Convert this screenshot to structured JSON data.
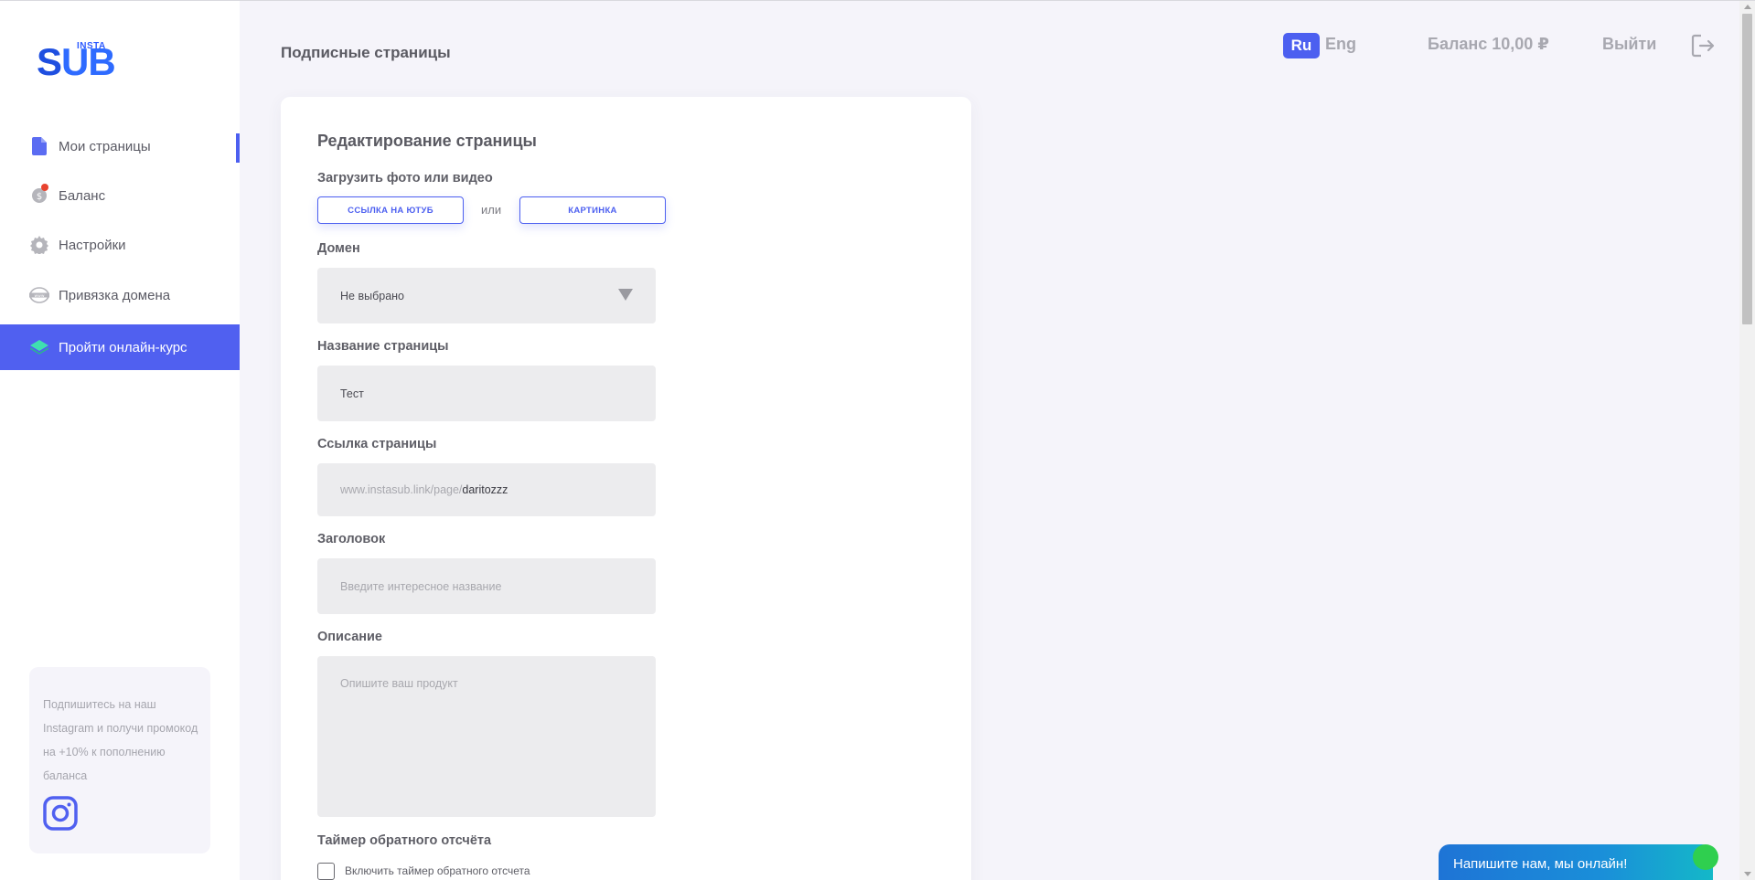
{
  "logo": {
    "insta": "INSTA",
    "sub_s": "S",
    "sub_rest": "UB"
  },
  "sidebar": {
    "items": [
      {
        "label": "Мои страницы",
        "icon": "document-icon"
      },
      {
        "label": "Баланс",
        "icon": "coin-icon"
      },
      {
        "label": "Настройки",
        "icon": "gear-icon"
      },
      {
        "label": "Привязка домена",
        "icon": "www-icon"
      },
      {
        "label": "Пройти онлайн-курс",
        "icon": "layers-icon"
      }
    ],
    "promo": {
      "text": "Подпишитесь на наш Instagram и получи промокод на +10% к пополнению баланса",
      "icon": "instagram-icon"
    }
  },
  "header": {
    "title": "Подписные страницы",
    "lang_ru": "Ru",
    "lang_eng": "Eng",
    "balance": "Баланс 10,00 ₽",
    "logout": "Выйти"
  },
  "form": {
    "title": "Редактирование страницы",
    "upload_label": "Загрузить фото или видео",
    "youtube_button": "ССЫЛКА НА ЮТУБ",
    "or": "или",
    "image_button": "КАРТИНКА",
    "domain_label": "Домен",
    "domain_value": "Не выбрано",
    "page_name_label": "Название страницы",
    "page_name_value": "Тест",
    "page_link_label": "Ссылка страницы",
    "page_link_prefix": "www.instasub.link/page/",
    "page_link_value": "daritozzz",
    "heading_label": "Заголовок",
    "heading_placeholder": "Введите интересное название",
    "description_label": "Описание",
    "description_placeholder": "Опишите ваш продукт",
    "timer_label": "Таймер обратного отсчёта",
    "timer_checkbox_label": "Включить таймер обратного отсчета"
  },
  "chat": {
    "text": "Напишите нам, мы онлайн!"
  },
  "colors": {
    "accent": "#4c5ff0",
    "sidebar_active": "#5060f0"
  }
}
